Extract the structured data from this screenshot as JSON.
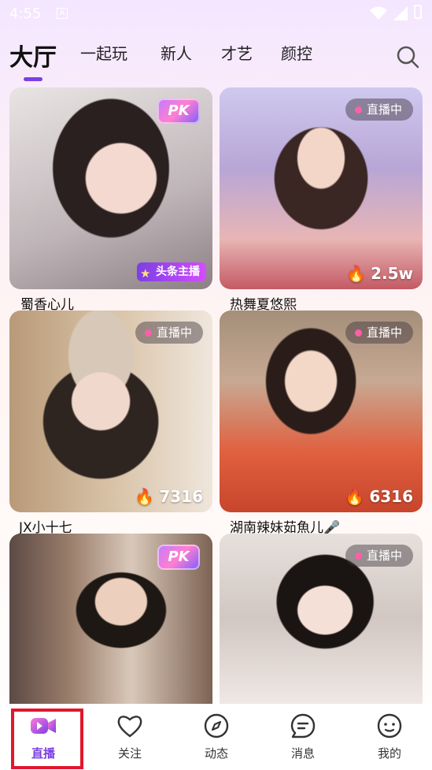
{
  "status_bar": {
    "time": "4:55",
    "indicator": "A"
  },
  "tabs": [
    {
      "label": "大厅",
      "active": true
    },
    {
      "label": "一起玩"
    },
    {
      "label": "新人"
    },
    {
      "label": "才艺"
    },
    {
      "label": "颜控"
    }
  ],
  "cards": [
    {
      "name": "蜀香心儿",
      "pk": "PK",
      "headline": "头条主播"
    },
    {
      "name": "热舞夏悠熙",
      "status": "直播中",
      "viewers": "2.5w"
    },
    {
      "name": "JX小十七",
      "status": "直播中",
      "viewers": "7316"
    },
    {
      "name": "湖南辣妹茹魚儿🎤",
      "status": "直播中",
      "viewers": "6316"
    },
    {
      "pk": "PK"
    },
    {
      "status": "直播中"
    }
  ],
  "bottom_nav": [
    {
      "label": "直播",
      "icon": "live-video-icon",
      "active": true
    },
    {
      "label": "关注",
      "icon": "heart-icon"
    },
    {
      "label": "动态",
      "icon": "compass-icon"
    },
    {
      "label": "消息",
      "icon": "message-icon"
    },
    {
      "label": "我的",
      "icon": "profile-face-icon"
    }
  ],
  "colors": {
    "accent": "#7b3fe4",
    "live_dot": "#ff5fa8",
    "selection": "#e3162b"
  }
}
